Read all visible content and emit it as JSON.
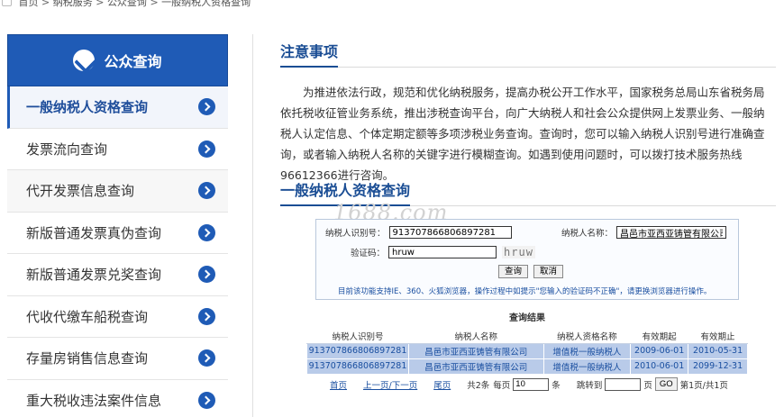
{
  "breadcrumb": {
    "home": "首页",
    "sep": ">",
    "level1": "纳税服务",
    "level2": "公众查询",
    "level3": "一般纳税人资格查询"
  },
  "sidebar": {
    "title": "公众查询",
    "items": [
      {
        "label": "一般纳税人资格查询"
      },
      {
        "label": "发票流向查询"
      },
      {
        "label": "代开发票信息查询"
      },
      {
        "label": "新版普通发票真伪查询"
      },
      {
        "label": "新版普通发票兑奖查询"
      },
      {
        "label": "代收代缴车船税查询"
      },
      {
        "label": "存量房销售信息查询"
      },
      {
        "label": "重大税收违法案件信息"
      }
    ]
  },
  "notice": {
    "title": "注意事项",
    "text": "为推进依法行政，规范和优化纳税服务，提高办税公开工作水平，国家税务总局山东省税务局依托税收征管业务系统，推出涉税查询平台，向广大纳税人和社会公众提供网上发票业务、一般纳税人认定信息、个体定期定额等多项涉税业务查询。查询时，您可以输入纳税人识别号进行准确查询，或者输入纳税人名称的关键字进行模糊查询。如遇到使用问题时，可以拨打技术服务热线96612366进行咨询。"
  },
  "watermark": "1688.com",
  "query": {
    "title": "一般纳税人资格查询",
    "taxpayer_id_label": "纳税人识别号：",
    "taxpayer_id_value": "913707866806897281",
    "taxpayer_name_label": "纳税人名称：",
    "taxpayer_name_value": "昌邑市亚西亚铸管有限公司",
    "captcha_label": "验证码：",
    "captcha_value": "hruw",
    "captcha_image_text": "hruw",
    "query_button": "查询",
    "cancel_button": "取消",
    "note": "目前该功能支持IE、360、火狐浏览器，操作过程中如提示\"您输入的验证码不正确\"，请更换浏览器进行操作。"
  },
  "results": {
    "title": "查询结果",
    "columns": [
      "纳税人识别号",
      "纳税人名称",
      "纳税人资格名称",
      "有效期起",
      "有效期止"
    ],
    "rows": [
      [
        "913707866806897281",
        "昌邑市亚西亚铸管有限公司",
        "增值税一般纳税人",
        "2009-06-01",
        "2010-05-31"
      ],
      [
        "913707866806897281",
        "昌邑市亚西亚铸管有限公司",
        "增值税一般纳税人",
        "2010-06-01",
        "2099-12-31"
      ]
    ]
  },
  "pager": {
    "first": "首页",
    "prev_next": "上一页/下一页",
    "last": "尾页",
    "total": "共2条",
    "per_page_label": "每页",
    "per_page_value": "10",
    "per_page_unit": "条",
    "jump_label": "跳转到",
    "jump_value": "",
    "jump_unit": "页",
    "go": "GO",
    "page_info": "第1页/共1页"
  },
  "colors": {
    "brand_blue": "#1f5bb6",
    "title_blue": "#1a4d94",
    "row_highlight": "#b9cbe9"
  }
}
